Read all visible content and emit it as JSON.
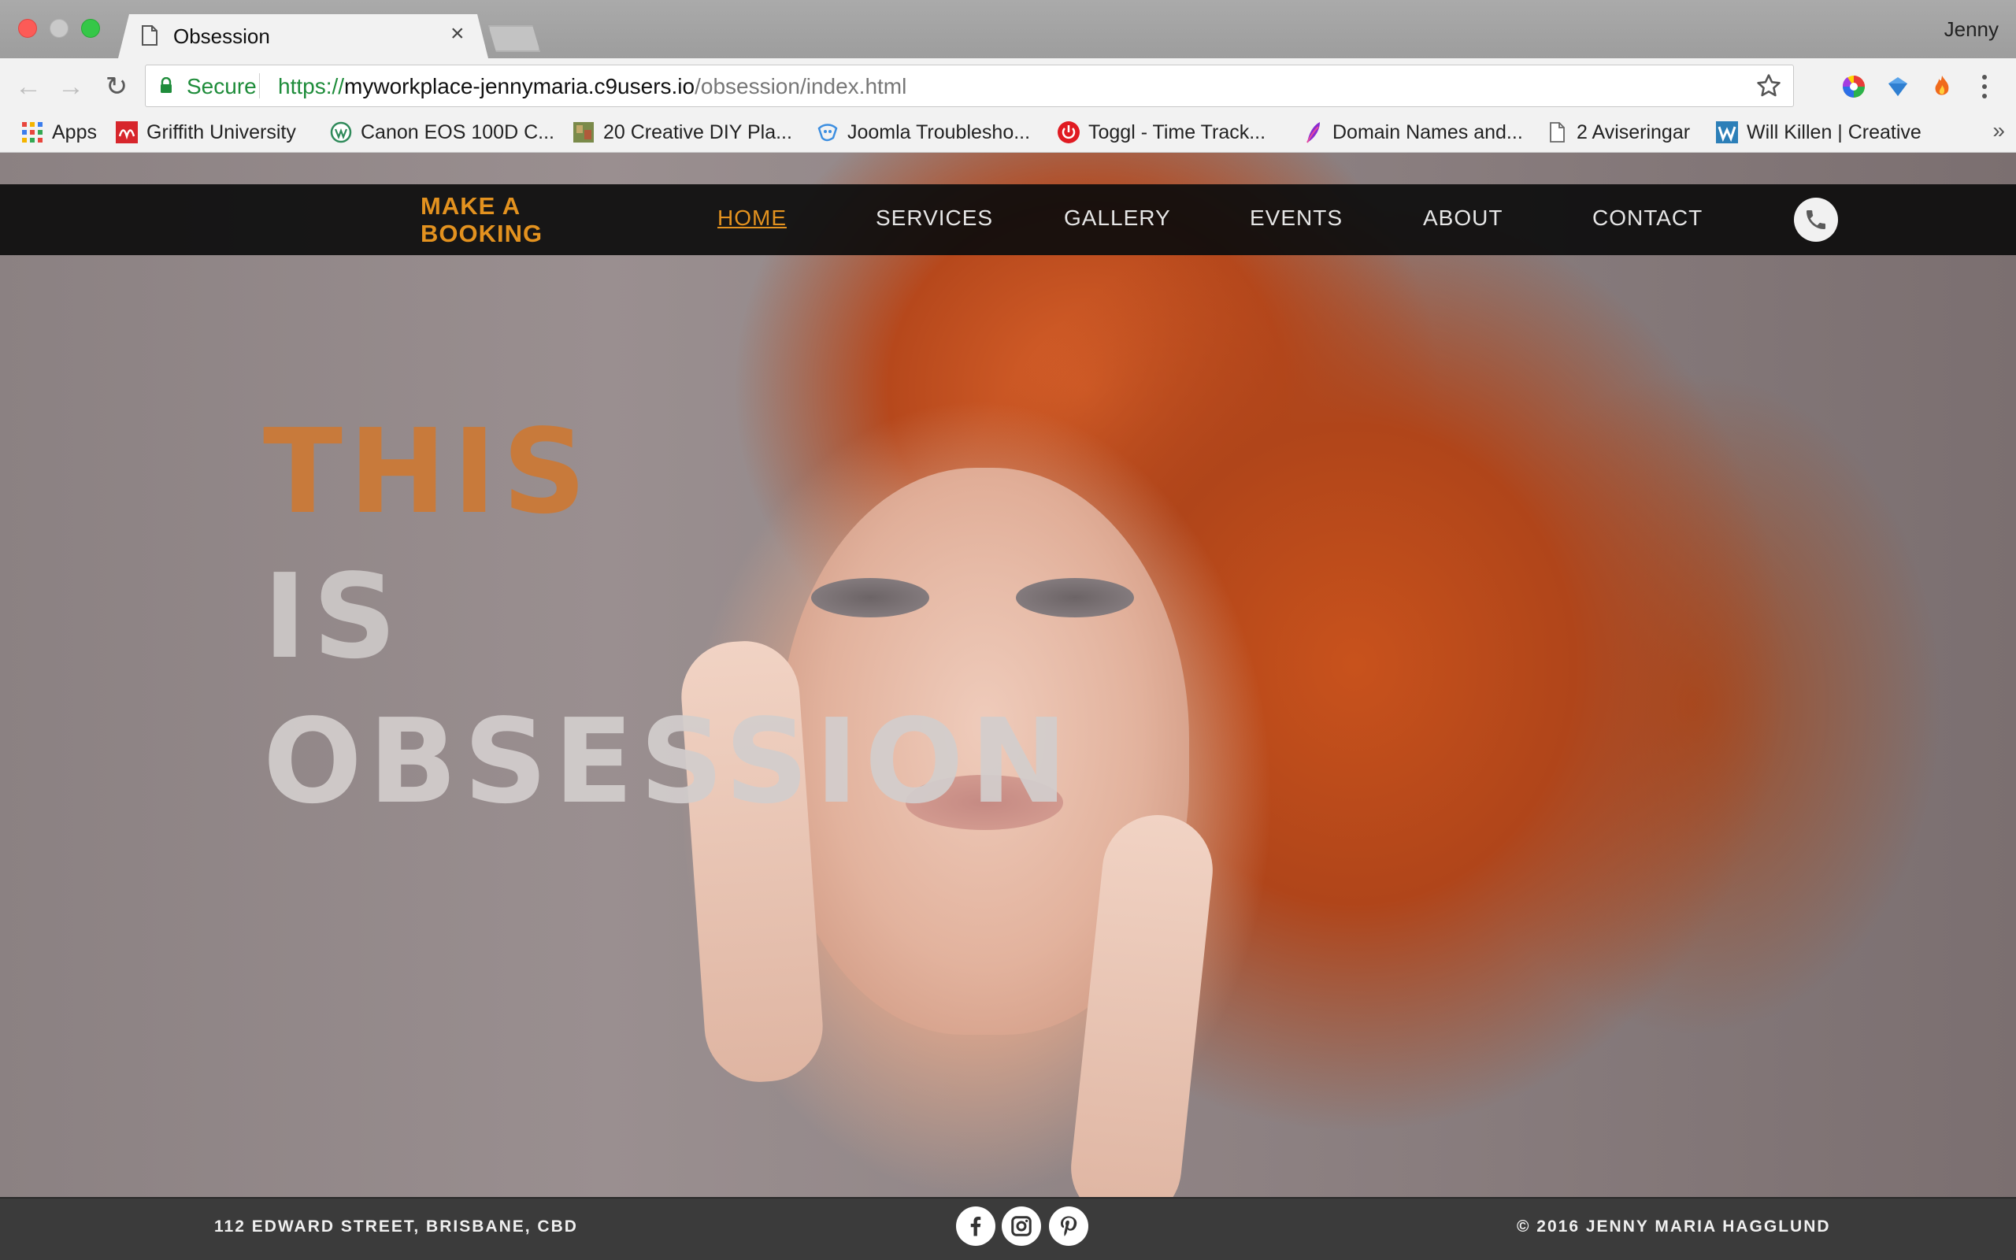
{
  "browser": {
    "tab_title": "Obsession",
    "profile_name": "Jenny",
    "secure_label": "Secure",
    "url_scheme": "https://",
    "url_host": "myworkplace-jennymaria.c9users.io",
    "url_path": "/obsession/index.html",
    "bookmarks": [
      {
        "label": "Apps",
        "icon": "apps-grid-icon"
      },
      {
        "label": "Griffith University",
        "icon": "griffith-logo-icon"
      },
      {
        "label": "Canon EOS 100D C...",
        "icon": "globe-icon"
      },
      {
        "label": "20 Creative DIY Pla...",
        "icon": "diy-thumbnail-icon"
      },
      {
        "label": "Joomla Troublesho...",
        "icon": "joomla-icon"
      },
      {
        "label": "Toggl - Time Track...",
        "icon": "toggl-power-icon"
      },
      {
        "label": "Domain Names and...",
        "icon": "feather-icon"
      },
      {
        "label": "2 Aviseringar",
        "icon": "page-icon"
      },
      {
        "label": "Will Killen | Creative",
        "icon": "w-logo-icon"
      }
    ],
    "bookmarks_overflow": "»"
  },
  "site": {
    "booking_line1": "MAKE A",
    "booking_line2": "BOOKING",
    "nav": {
      "home": "HOME",
      "services": "SERVICES",
      "gallery": "GALLERY",
      "events": "EVENTS",
      "about": "ABOUT",
      "contact": "CONTACT"
    },
    "headline": {
      "line1": "THIS",
      "line2": "IS",
      "line3": "OBSESSION"
    },
    "footer": {
      "address": "112 EDWARD STREET, BRISBANE, CBD",
      "copyright": "© 2016 JENNY MARIA HAGGLUND"
    },
    "accent_color": "#e3921f"
  }
}
